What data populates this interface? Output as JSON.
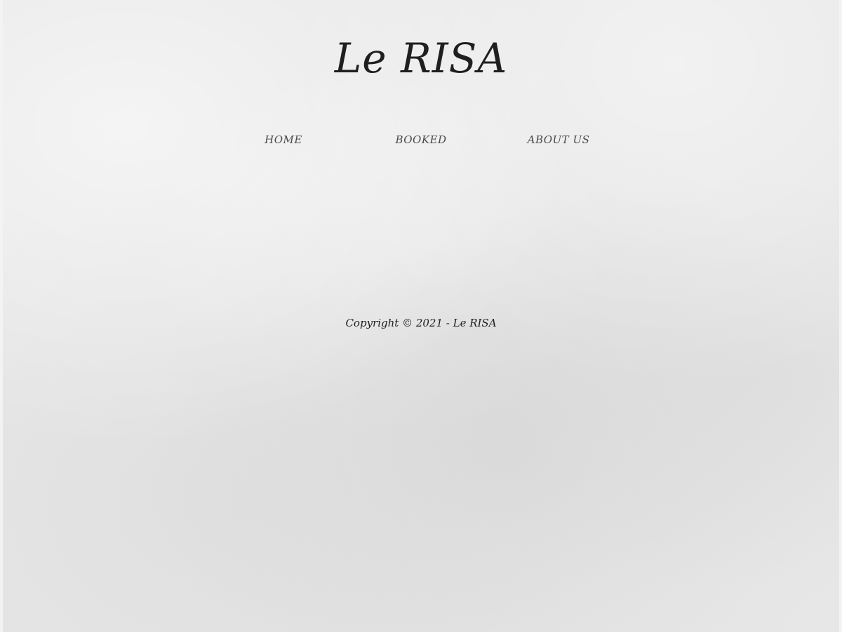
{
  "header": {
    "site_title": "Le RISA"
  },
  "nav": {
    "items": [
      {
        "label": "HOME"
      },
      {
        "label": "BOOKED"
      },
      {
        "label": "ABOUT US"
      }
    ]
  },
  "footer": {
    "copyright": "Copyright © 2021 - Le RISA"
  },
  "colors": {
    "background": "#e7e7e7",
    "title_text": "#1f1f1f",
    "nav_text": "#4a4a4a"
  }
}
